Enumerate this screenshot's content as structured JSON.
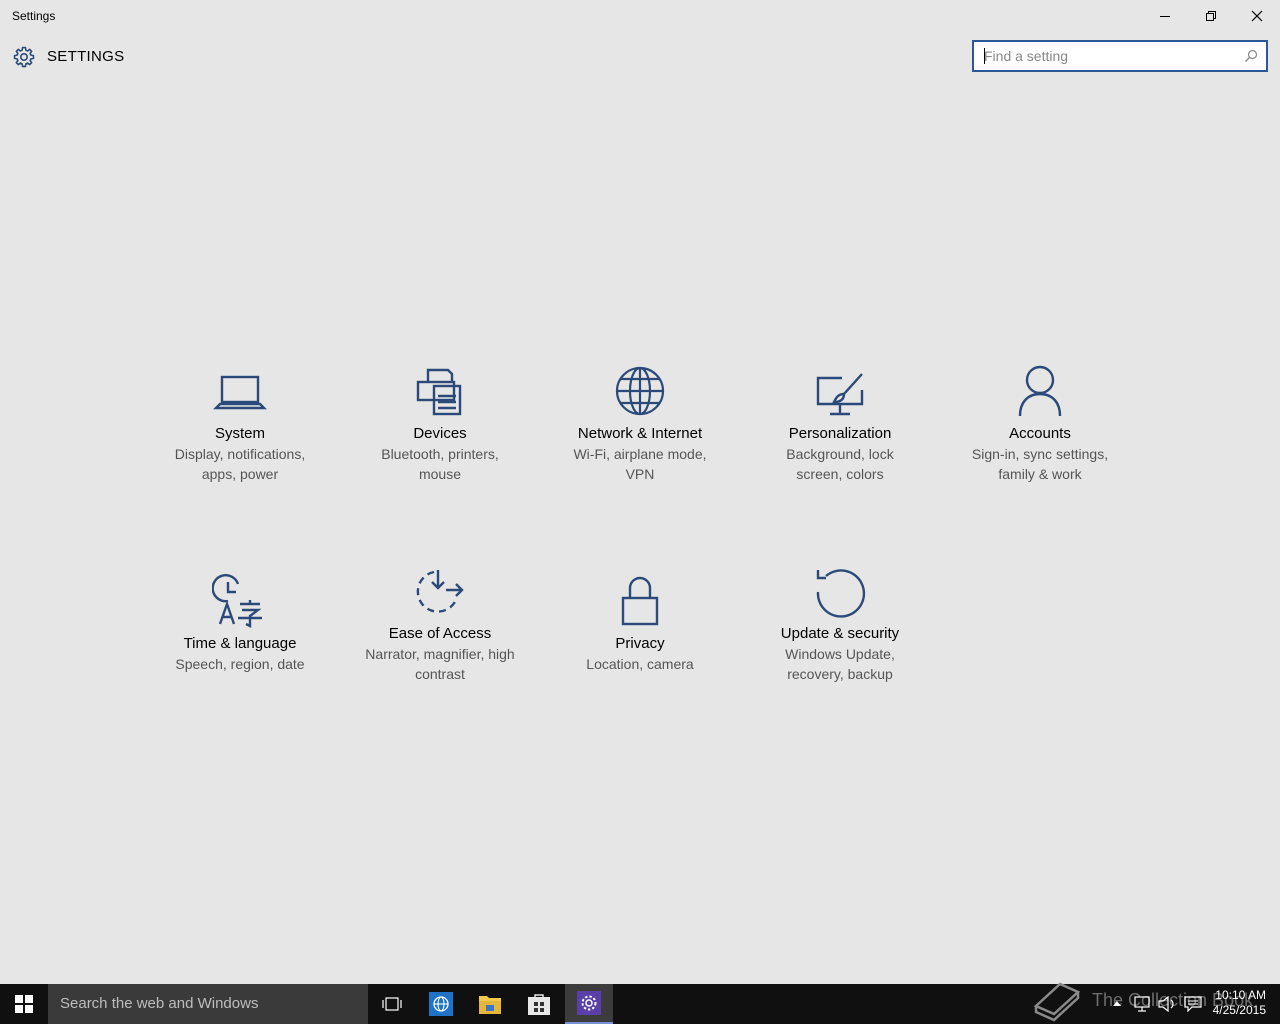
{
  "window": {
    "title": "Settings",
    "minimize_icon": "minimize-icon",
    "restore_icon": "restore-icon",
    "close_icon": "close-icon"
  },
  "header": {
    "icon": "gear-icon",
    "title": "SETTINGS",
    "search_placeholder": "Find a setting",
    "search_value": ""
  },
  "tiles": [
    {
      "icon": "laptop-icon",
      "label": "System",
      "desc": "Display, notifications, apps, power"
    },
    {
      "icon": "printer-icon",
      "label": "Devices",
      "desc": "Bluetooth, printers, mouse"
    },
    {
      "icon": "globe-icon",
      "label": "Network & Internet",
      "desc": "Wi-Fi, airplane mode, VPN"
    },
    {
      "icon": "paintbrush-monitor-icon",
      "label": "Personalization",
      "desc": "Background, lock screen, colors"
    },
    {
      "icon": "person-icon",
      "label": "Accounts",
      "desc": "Sign-in, sync settings, family & work"
    },
    {
      "icon": "clock-language-icon",
      "label": "Time & language",
      "desc": "Speech, region, date"
    },
    {
      "icon": "ease-of-access-icon",
      "label": "Ease of Access",
      "desc": "Narrator, magnifier, high contrast"
    },
    {
      "icon": "lock-icon",
      "label": "Privacy",
      "desc": "Location, camera"
    },
    {
      "icon": "refresh-icon",
      "label": "Update & security",
      "desc": "Windows Update, recovery, backup"
    }
  ],
  "taskbar": {
    "search_placeholder": "Search the web and Windows",
    "apps": [
      "task-view-icon",
      "internet-explorer-icon",
      "file-explorer-icon",
      "store-icon",
      "settings-icon"
    ],
    "watermark": "The Collection Book",
    "time": "10:10 AM",
    "date": "4/25/2015"
  },
  "colors": {
    "accent": "#2b4a7a",
    "background": "#e6e6e6",
    "taskbar": "#101010"
  }
}
